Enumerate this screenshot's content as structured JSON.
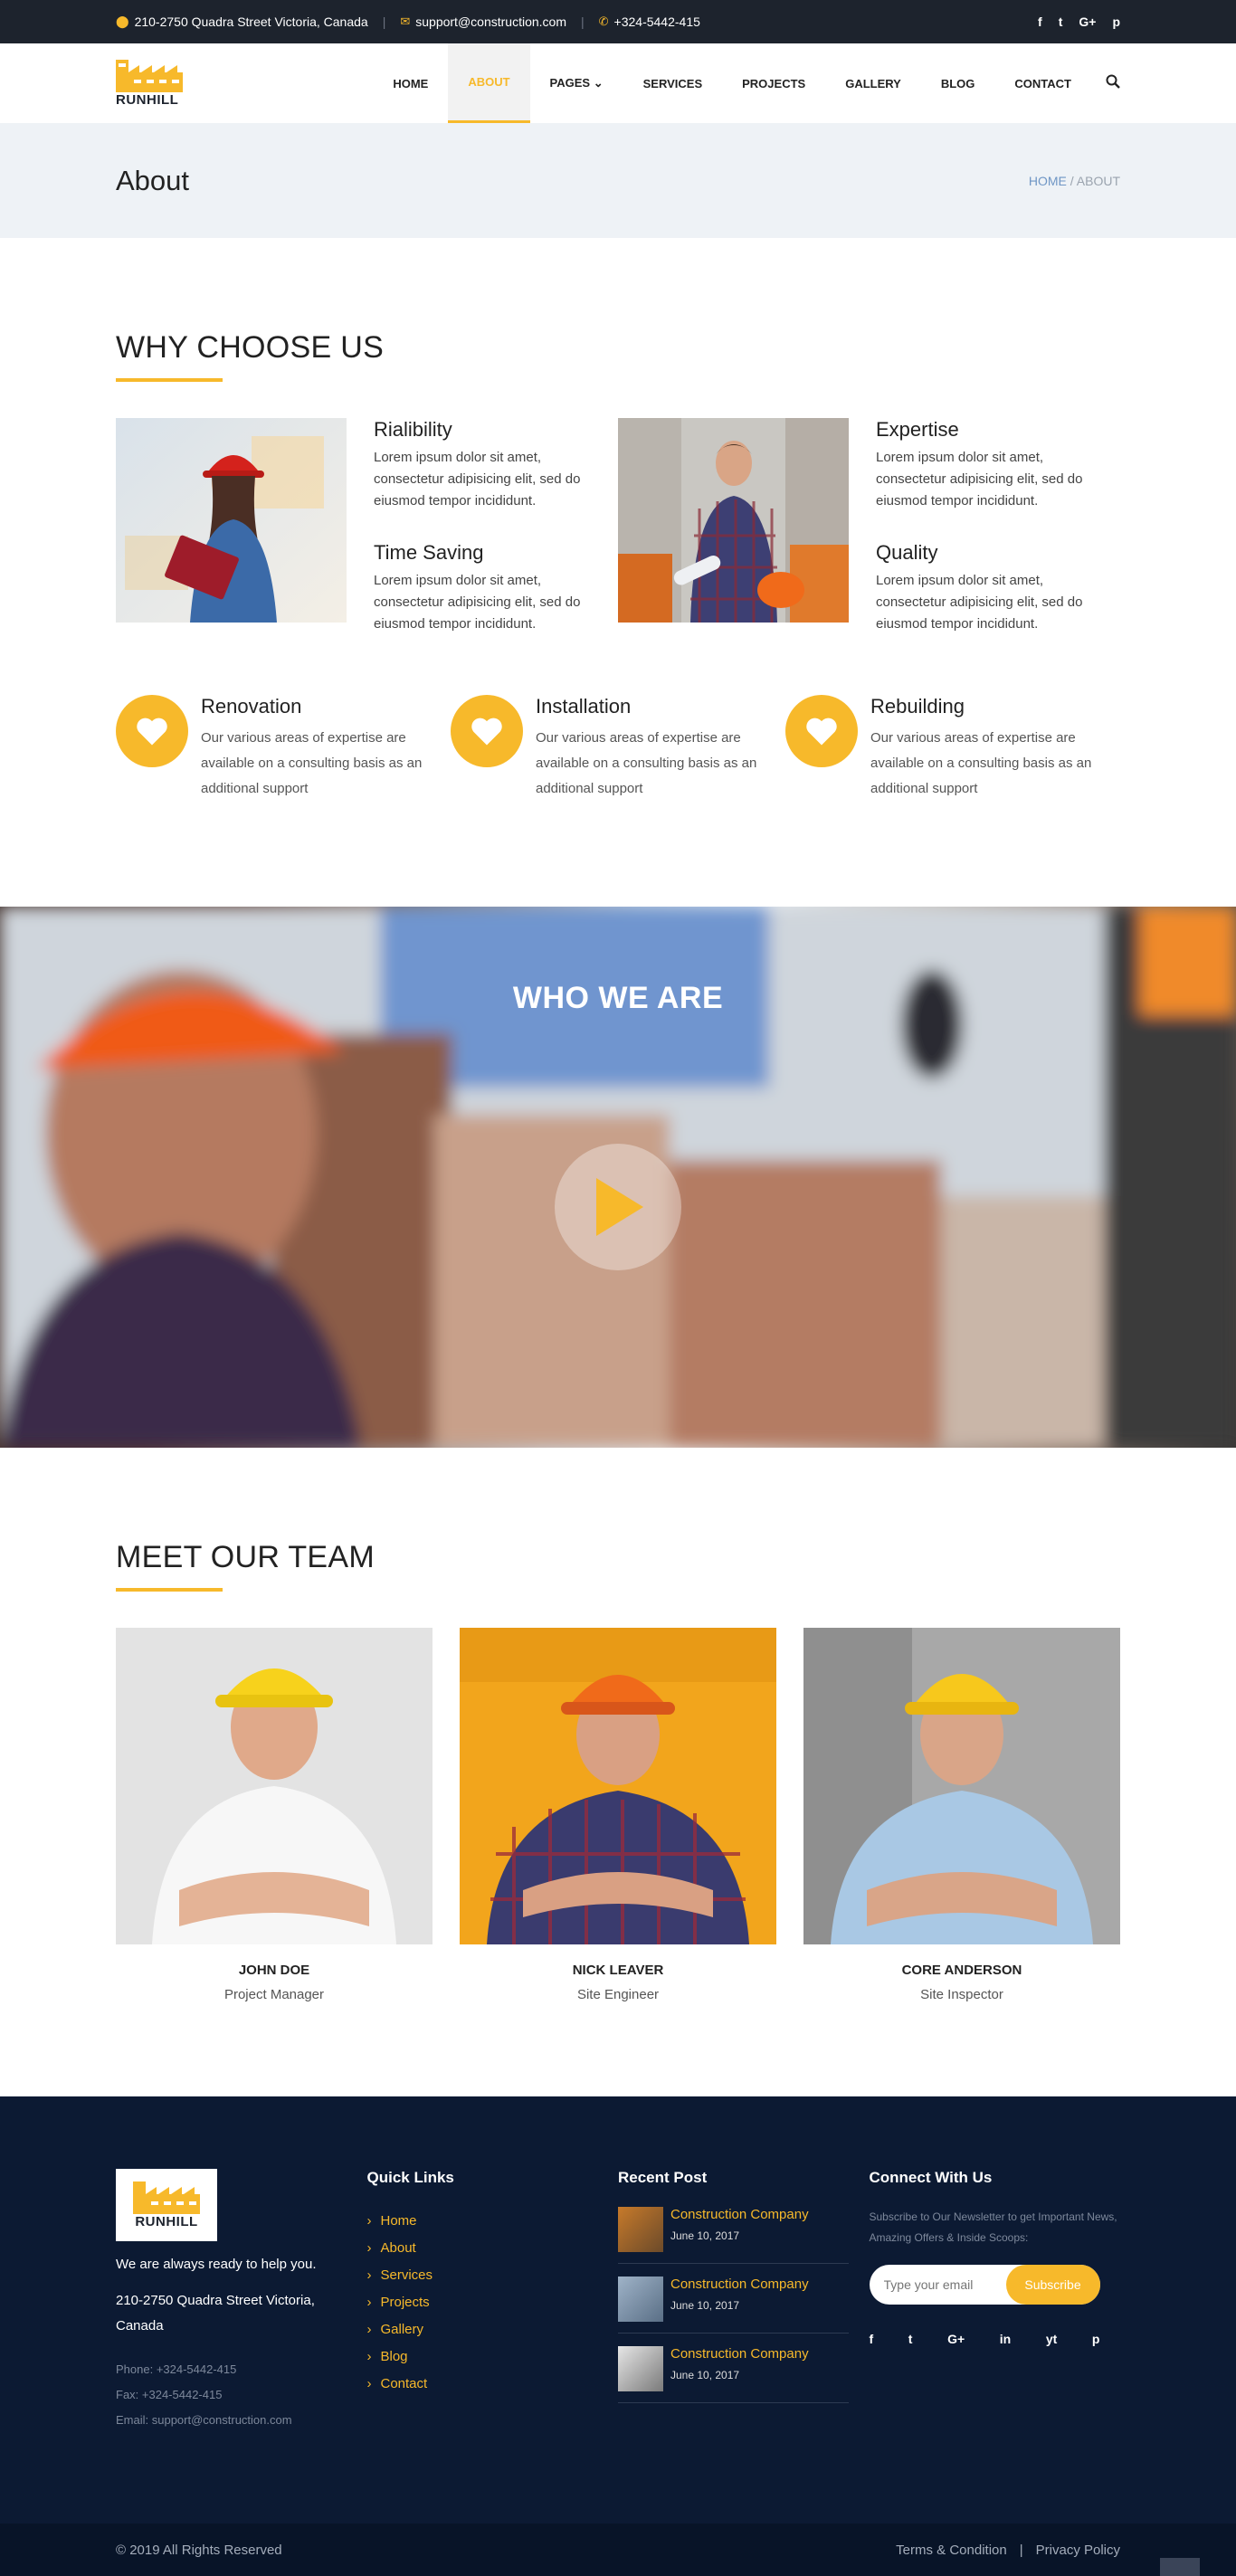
{
  "topbar": {
    "address": "210-2750 Quadra Street Victoria, Canada",
    "email": "support@construction.com",
    "phone": "+324-5442-415",
    "social": [
      "f",
      "t",
      "G+",
      "p"
    ]
  },
  "logo": {
    "text": "RUNHILL"
  },
  "nav": {
    "items": [
      {
        "label": "HOME"
      },
      {
        "label": "ABOUT"
      },
      {
        "label": "PAGES ⌄"
      },
      {
        "label": "SERVICES"
      },
      {
        "label": "PROJECTS"
      },
      {
        "label": "GALLERY"
      },
      {
        "label": "BLOG"
      },
      {
        "label": "CONTACT"
      }
    ],
    "active": "ABOUT"
  },
  "page_title": {
    "title": "About",
    "breadcrumb_home": "HOME",
    "breadcrumb_sep": " / ",
    "breadcrumb_current": "ABOUT"
  },
  "why": {
    "title": "WHY CHOOSE US",
    "blocks": [
      {
        "title": "Rialibility",
        "text": "Lorem ipsum dolor sit amet, consectetur adipisicing elit, sed do eiusmod tempor incididunt."
      },
      {
        "title": "Time Saving",
        "text": "Lorem ipsum dolor sit amet, consectetur adipisicing elit, sed do eiusmod tempor incididunt."
      },
      {
        "title": "Expertise",
        "text": "Lorem ipsum dolor sit amet, consectetur adipisicing elit, sed do eiusmod tempor incididunt."
      },
      {
        "title": "Quality",
        "text": "Lorem ipsum dolor sit amet, consectetur adipisicing elit, sed do eiusmod tempor incididunt."
      }
    ],
    "features": [
      {
        "title": "Renovation",
        "text": "Our various areas of expertise are available on a consulting basis as an additional support"
      },
      {
        "title": "Installation",
        "text": "Our various areas of expertise are available on a consulting basis as an additional support"
      },
      {
        "title": "Rebuilding",
        "text": "Our various areas of expertise are available on a consulting basis as an additional support"
      }
    ]
  },
  "video": {
    "title": "WHO WE ARE"
  },
  "team": {
    "title": "MEET OUR TEAM",
    "members": [
      {
        "name": "JOHN DOE",
        "role": "Project Manager"
      },
      {
        "name": "NICK LEAVER",
        "role": "Site Engineer"
      },
      {
        "name": "CORE ANDERSON",
        "role": "Site Inspector"
      }
    ]
  },
  "footer": {
    "logo_text": "RUNHILL",
    "tagline": "We are always ready to help you.",
    "address": "210-2750 Quadra Street Victoria, Canada",
    "phone": "Phone: +324-5442-415",
    "fax": "Fax: +324-5442-415",
    "email": "Email: support@construction.com",
    "quick_links_title": "Quick Links",
    "quick_links": [
      "Home",
      "About",
      "Services",
      "Projects",
      "Gallery",
      "Blog",
      "Contact"
    ],
    "recent_title": "Recent Post",
    "posts": [
      {
        "title": "Construction Company",
        "date": "June 10, 2017"
      },
      {
        "title": "Construction Company",
        "date": "June 10, 2017"
      },
      {
        "title": "Construction Company",
        "date": "June 10, 2017"
      }
    ],
    "connect_title": "Connect With Us",
    "newsletter_text": "Subscribe to Our Newsletter to get Important News, Amazing Offers & Inside Scoops:",
    "email_placeholder": "Type your email",
    "subscribe_label": "Subscribe",
    "social": [
      "f",
      "t",
      "G+",
      "in",
      "yt",
      "p"
    ]
  },
  "bottombar": {
    "copyright": "© 2019 All Rights Reserved",
    "terms": "Terms & Condition",
    "sep": "|",
    "privacy": "Privacy Policy"
  },
  "colors": {
    "accent": "#f7b92b",
    "dark": "#1d232d",
    "footer": "#0c1a33"
  }
}
